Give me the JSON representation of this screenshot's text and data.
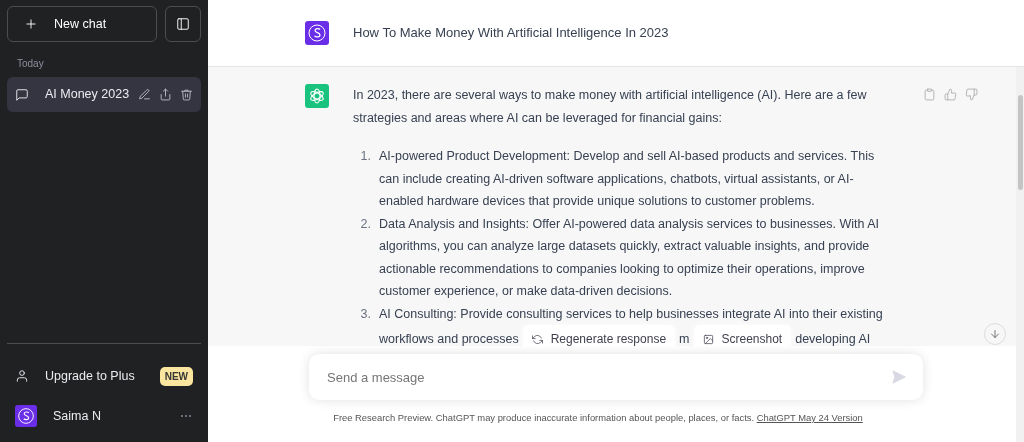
{
  "sidebar": {
    "new_chat": "New chat",
    "section": "Today",
    "chats": [
      {
        "title": "AI Money 2023",
        "selected": true
      }
    ],
    "upgrade": {
      "label": "Upgrade to Plus",
      "badge": "NEW"
    },
    "user": {
      "name": "Saima N"
    }
  },
  "conversation_title": "How To Make Money With Artificial Intelligence In 2023",
  "answer": {
    "intro": "In 2023, there are several ways to make money with artificial intelligence (AI). Here are a few strategies and areas where AI can be leveraged for financial gains:",
    "items": [
      {
        "number": "1.",
        "text": "AI-powered Product Development: Develop and sell AI-based products and services. This can include creating AI-driven software applications, chatbots, virtual assistants, or AI-enabled hardware devices that provide unique solutions to customer problems."
      },
      {
        "number": "2.",
        "text": "Data Analysis and Insights: Offer AI-powered data analysis services to businesses. With AI algorithms, you can analyze large datasets quickly, extract valuable insights, and provide actionable recommendations to companies looking to optimize their operations, improve customer experience, or make data-driven decisions."
      },
      {
        "number": "3.",
        "text": "AI Consulting: Provide consulting services to help businesses integrate AI into their existing",
        "fragments": [
          "workflows and processes",
          "m",
          "developing AI"
        ]
      }
    ]
  },
  "actions": [
    {
      "kind": "regenerate",
      "label": "Regenerate response"
    },
    {
      "kind": "screenshot",
      "label": "Screenshot"
    }
  ],
  "composer": {
    "placeholder": "Send a message"
  },
  "footer": {
    "text": "Free Research Preview. ChatGPT may produce inaccurate information about people, places, or facts.",
    "link": "ChatGPT May 24 Version"
  }
}
